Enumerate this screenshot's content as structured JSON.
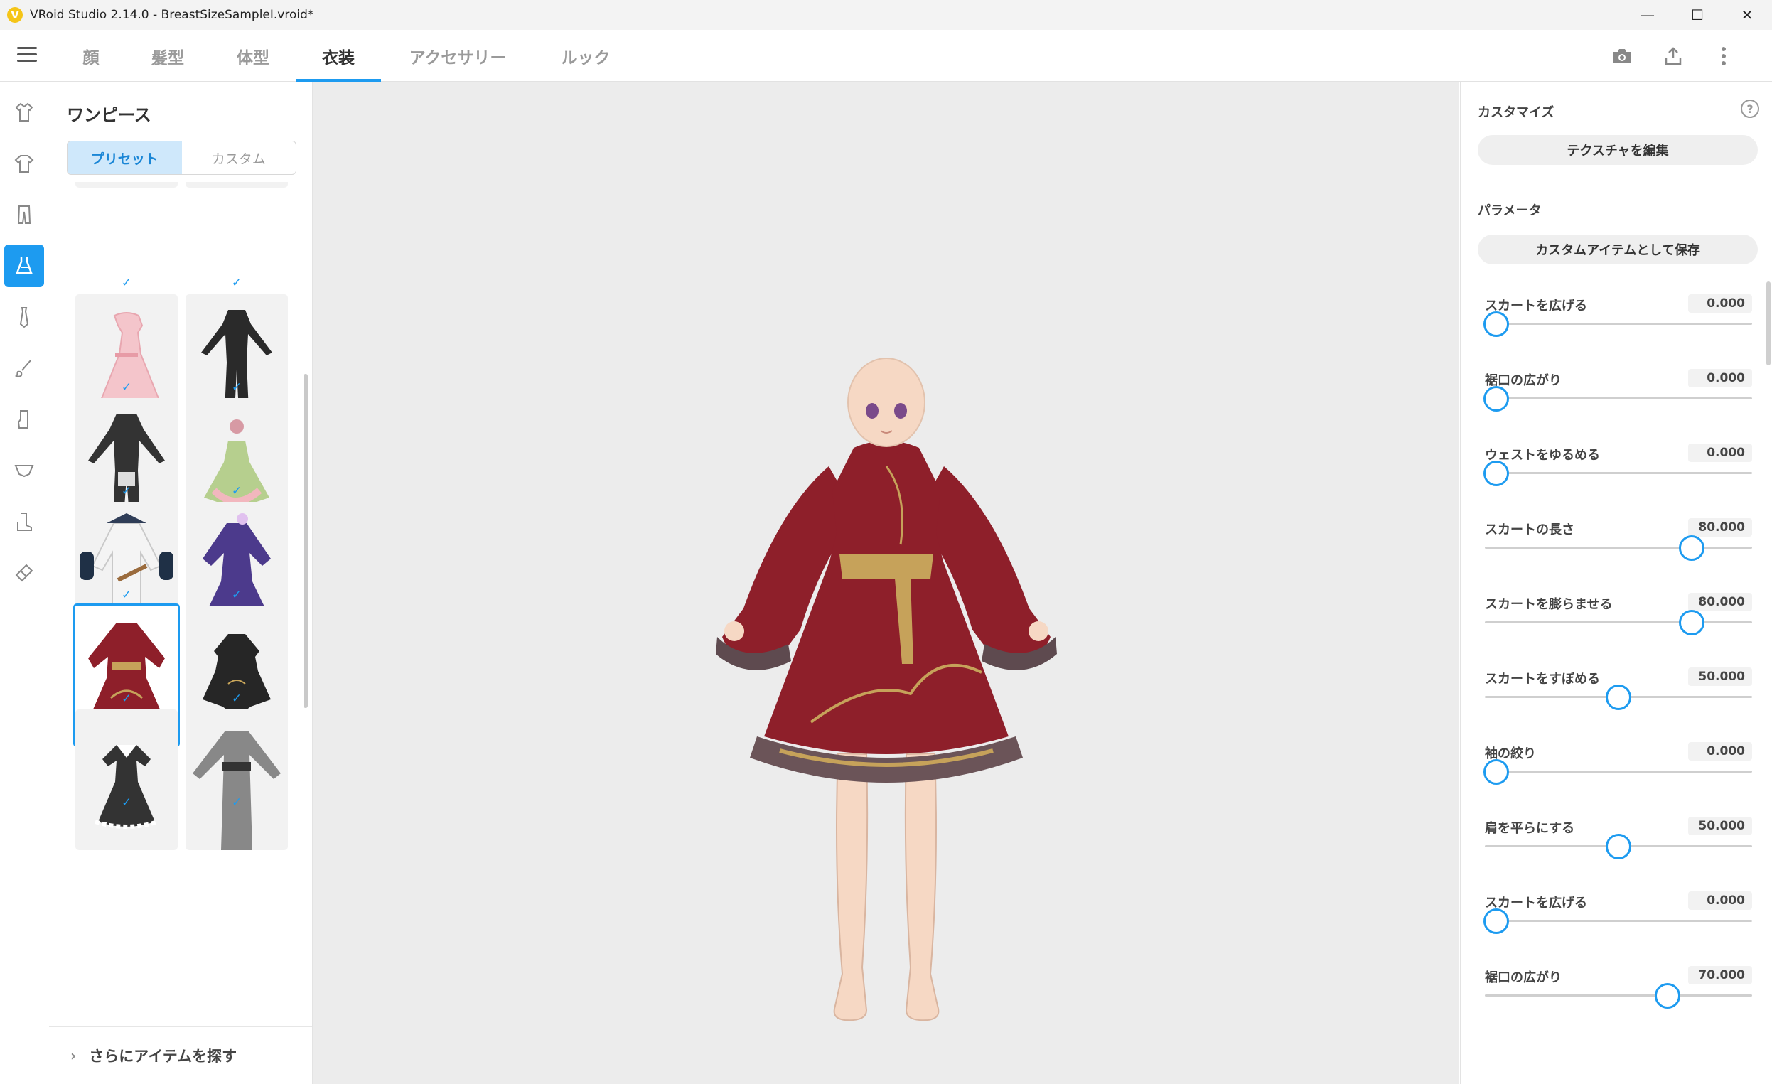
{
  "window": {
    "title": "VRoid Studio 2.14.0 - BreastSizeSampleI.vroid*",
    "logo_letter": "V",
    "minimize": "—",
    "maximize": "☐",
    "close": "✕"
  },
  "topnav": {
    "tabs": [
      {
        "label": "顔",
        "active": false
      },
      {
        "label": "髪型",
        "active": false
      },
      {
        "label": "体型",
        "active": false
      },
      {
        "label": "衣装",
        "active": true
      },
      {
        "label": "アクセサリー",
        "active": false
      },
      {
        "label": "ルック",
        "active": false
      }
    ],
    "icons": [
      "camera-icon",
      "export-icon",
      "more-vertical-icon"
    ]
  },
  "rail": {
    "icons": [
      "tops-icon",
      "tshirt-icon",
      "pants-icon",
      "onepiece-icon",
      "tie-icon",
      "brush-icon",
      "socks-icon",
      "underwear-icon",
      "boots-icon",
      "accessory-icon"
    ],
    "active_index": 3
  },
  "presets": {
    "title": "ワンピース",
    "segments": [
      "プリセット",
      "カスタム"
    ],
    "active_segment": 0,
    "check": "✓",
    "items": [
      {
        "name": "pink-lolita-dress",
        "selected": false
      },
      {
        "name": "black-bodysuit",
        "selected": false
      },
      {
        "name": "black-mecha-suit",
        "selected": false
      },
      {
        "name": "flower-fairy-dress",
        "selected": false
      },
      {
        "name": "white-robe",
        "selected": false
      },
      {
        "name": "purple-kimono-dress",
        "selected": false
      },
      {
        "name": "red-chinese-dress",
        "selected": true
      },
      {
        "name": "black-gothic-dress",
        "selected": false
      },
      {
        "name": "black-maid-dress",
        "selected": false
      },
      {
        "name": "grey-long-robe",
        "selected": false
      }
    ],
    "more_label": "さらにアイテムを探す",
    "more_chevron": "›"
  },
  "customize": {
    "title": "カスタマイズ",
    "help": "?",
    "texture_button": "テクスチャを編集",
    "params_title": "パラメータ",
    "save_button": "カスタムアイテムとして保存",
    "params": [
      {
        "label": "スカートを広げる",
        "value": "0.000",
        "fraction": 0.0
      },
      {
        "label": "裾口の広がり",
        "value": "0.000",
        "fraction": 0.0
      },
      {
        "label": "ウェストをゆるめる",
        "value": "0.000",
        "fraction": 0.0
      },
      {
        "label": "スカートの長さ",
        "value": "80.000",
        "fraction": 0.8
      },
      {
        "label": "スカートを膨らませる",
        "value": "80.000",
        "fraction": 0.8
      },
      {
        "label": "スカートをすぼめる",
        "value": "50.000",
        "fraction": 0.5
      },
      {
        "label": "袖の絞り",
        "value": "0.000",
        "fraction": 0.0
      },
      {
        "label": "肩を平らにする",
        "value": "50.000",
        "fraction": 0.5
      },
      {
        "label": "スカートを広げる",
        "value": "0.000",
        "fraction": 0.0
      },
      {
        "label": "裾口の広がり",
        "value": "70.000",
        "fraction": 0.7
      }
    ]
  },
  "colors": {
    "accent": "#1d9bf0",
    "dress_red": "#8e1f2a",
    "dress_gold": "#c6a25a",
    "skin": "#f6d8c4"
  }
}
